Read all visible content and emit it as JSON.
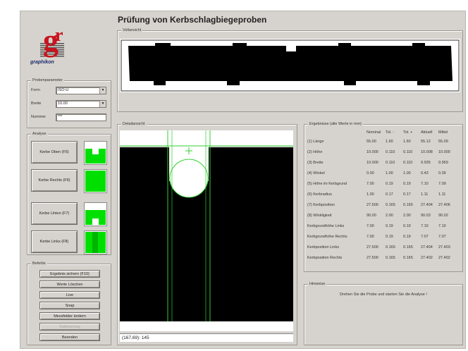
{
  "title": "Prüfung von Kerbschlagbiegeproben",
  "logo": {
    "text": "graphikon"
  },
  "vollansicht": {
    "title": "Vollansicht"
  },
  "probenparameter": {
    "title": "Probenparameter",
    "form_label": "Form",
    "form_value": "ISO-U",
    "breite_label": "Breite",
    "breite_value": "10.00",
    "nummer_label": "Nummer",
    "nummer_value": "***"
  },
  "analyse": {
    "title": "Analyse",
    "buttons": [
      {
        "label": "Kerbe Oben (F5)",
        "icon": "notch-top-icon"
      },
      {
        "label": "Kerbe Rechts (F6)",
        "icon": "notch-right-icon"
      },
      {
        "label": "Kerbe Unten (F7)",
        "icon": "notch-bottom-icon"
      },
      {
        "label": "Kerbe Links (F8)",
        "icon": "notch-left-icon"
      }
    ]
  },
  "befehle": {
    "title": "Befehle",
    "buttons": [
      "Ergebnis sichern (F10)",
      "Werte Löschen",
      "Live",
      "Snap",
      "Messfelder ändern",
      "Kalibrierung",
      "Beenden"
    ],
    "disabled_index": 5
  },
  "detailansicht": {
    "title": "Detailansicht",
    "status": "(167,69): 145"
  },
  "ergebnisse": {
    "title": "Ergebnisse  (alle Werte in mm)",
    "columns": [
      "Nominal",
      "Tol. -",
      "Tol. +",
      "Aktuell",
      "Mittel"
    ],
    "rows": [
      {
        "name": "(1) Länge",
        "values": [
          "55.00",
          "1.60",
          "1.60",
          "55.12",
          "55.09"
        ]
      },
      {
        "name": "(2) Höhe",
        "values": [
          "10.000",
          "0.110",
          "0.110",
          "10.008",
          "10.000"
        ]
      },
      {
        "name": "(3) Breite",
        "values": [
          "10.000",
          "0.110",
          "0.110",
          "9.935",
          "9.959"
        ]
      },
      {
        "name": "(4) Winkel",
        "values": [
          "0.00",
          "1.00",
          "1.00",
          "0.43",
          "0.39"
        ]
      },
      {
        "name": "(5) Höhe im Kerbgrund",
        "values": [
          "7.00",
          "0.19",
          "0.19",
          "7.10",
          "7.09"
        ]
      },
      {
        "name": "(6) Kerbradius",
        "values": [
          "1.00",
          "0.17",
          "0.17",
          "1.11",
          "1.11"
        ]
      },
      {
        "name": "(7) Kerbposition",
        "values": [
          "27.500",
          "0.165",
          "0.165",
          "27.404",
          "27.406"
        ]
      },
      {
        "name": "(8) Winkligkeit",
        "values": [
          "90.00",
          "2.00",
          "2.00",
          "90.03",
          "90.02"
        ]
      },
      {
        "name": "Kerbgrundhöhe Links",
        "values": [
          "7.00",
          "0.19",
          "0.19",
          "7.10",
          "7.10"
        ]
      },
      {
        "name": "Kerbgrundhöhe Rechts",
        "values": [
          "7.00",
          "0.19",
          "0.19",
          "7.07",
          "7.07"
        ]
      },
      {
        "name": "Kerbposition Links",
        "values": [
          "27.500",
          "0.165",
          "0.165",
          "27.404",
          "27.403"
        ]
      },
      {
        "name": "Kerbposition Rechts",
        "values": [
          "27.500",
          "0.165",
          "0.165",
          "27.402",
          "27.402"
        ]
      }
    ]
  },
  "hinweise": {
    "title": "Hinweise",
    "text": "Drehen Sie die Probe und starten Sie die Analyse !"
  },
  "colors": {
    "window": "#d6d3ce",
    "overlay": "#2fd12f",
    "notch_icon": "#00e000",
    "logo_red": "#c8141e"
  }
}
